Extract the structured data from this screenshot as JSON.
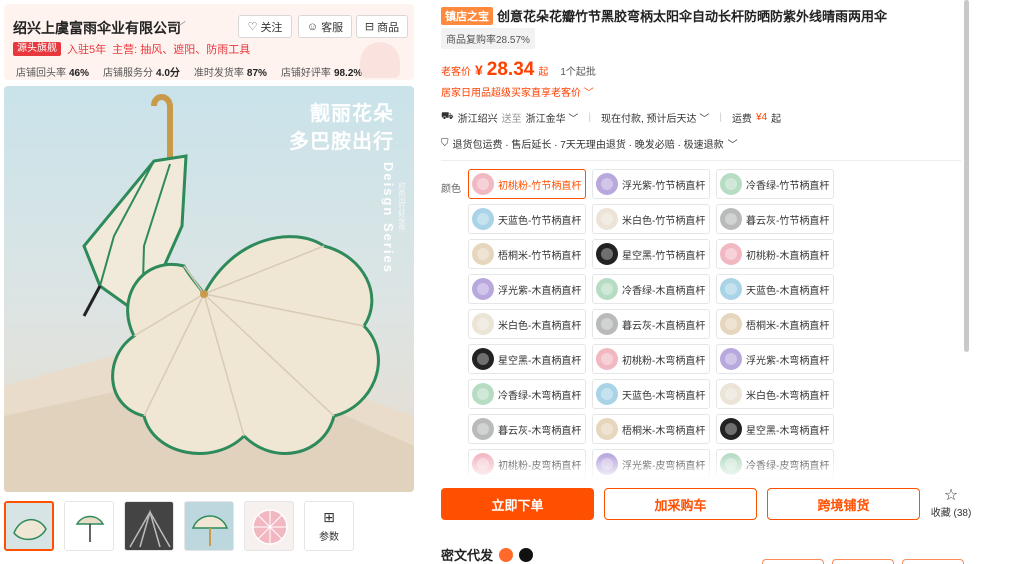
{
  "shop": {
    "name": "绍兴上虞富雨伞业有限公司",
    "follow_label": "关注",
    "service_label": "客服",
    "store_label": "商品",
    "badge": "源头旗舰",
    "years": "入驻5年",
    "main_products": "主营: 抽风、遮阳、防雨工具",
    "stats": [
      {
        "label": "店铺回头率",
        "value": "46%"
      },
      {
        "label": "店铺服务分",
        "value": "4.0分"
      },
      {
        "label": "准时发货率",
        "value": "87%"
      },
      {
        "label": "店铺好评率",
        "value": "98.2%"
      }
    ]
  },
  "main_image": {
    "headline_1": "靓丽花朵",
    "headline_2": "多巴胺出行",
    "series_text": "Deisgn Series",
    "series_sub": "时尚出行好伙伴"
  },
  "thumbnails": {
    "params_label": "参数"
  },
  "product": {
    "store_badge": "镇店之宝",
    "title": "创意花朵花瓣竹节黑胶弯柄太阳伞自动长杆防晒防紫外线晴雨两用伞",
    "repurchase": "商品复购率28.57%",
    "price_label": "老客价",
    "currency": "¥",
    "price": "28.34",
    "price_unit": "起",
    "min_order": "1个起批",
    "promo": "居家日用品超级买家直享老客价",
    "ship_from": "浙江绍兴",
    "ship_to_label": "送至",
    "ship_to": "浙江金华",
    "ship_time": "现在付款, 预计后天达",
    "freight_label": "运费",
    "freight": "¥4",
    "freight_unit": "起",
    "services": "退货包运费 · 售后延长 · 7天无理由退货 · 晚发必赔 · 极速退款",
    "color_label": "颜色"
  },
  "colors": [
    {
      "label": "初桃粉-竹节柄直杆",
      "color": "#f2b8c2",
      "selected": true
    },
    {
      "label": "浮光紫-竹节柄直杆",
      "color": "#b9a8dd"
    },
    {
      "label": "冷香绿-竹节柄直杆",
      "color": "#b7dcc4"
    },
    {
      "label": "天蓝色-竹节柄直杆",
      "color": "#a9d3e6"
    },
    {
      "label": "米白色-竹节柄直杆",
      "color": "#ece4d6"
    },
    {
      "label": "暮云灰-竹节柄直杆",
      "color": "#b9babb"
    },
    {
      "label": "梧桐米-竹节柄直杆",
      "color": "#e6d6bd"
    },
    {
      "label": "星空黑-竹节柄直杆",
      "color": "#222222"
    },
    {
      "label": "初桃粉-木直柄直杆",
      "color": "#f2b8c2"
    },
    {
      "label": "浮光紫-木直柄直杆",
      "color": "#b9a8dd"
    },
    {
      "label": "冷香绿-木直柄直杆",
      "color": "#b7dcc4"
    },
    {
      "label": "天蓝色-木直柄直杆",
      "color": "#a9d3e6"
    },
    {
      "label": "米白色-木直柄直杆",
      "color": "#ece4d6"
    },
    {
      "label": "暮云灰-木直柄直杆",
      "color": "#b9babb"
    },
    {
      "label": "梧桐米-木直柄直杆",
      "color": "#e6d6bd"
    },
    {
      "label": "星空黑-木直柄直杆",
      "color": "#222222"
    },
    {
      "label": "初桃粉-木弯柄直杆",
      "color": "#f2b8c2"
    },
    {
      "label": "浮光紫-木弯柄直杆",
      "color": "#b9a8dd"
    },
    {
      "label": "冷香绿-木弯柄直杆",
      "color": "#b7dcc4"
    },
    {
      "label": "天蓝色-木弯柄直杆",
      "color": "#a9d3e6"
    },
    {
      "label": "米白色-木弯柄直杆",
      "color": "#ece4d6"
    },
    {
      "label": "暮云灰-木弯柄直杆",
      "color": "#b9babb"
    },
    {
      "label": "梧桐米-木弯柄直杆",
      "color": "#e6d6bd"
    },
    {
      "label": "星空黑-木弯柄直杆",
      "color": "#222222"
    },
    {
      "label": "初桃粉-皮弯柄直杆",
      "color": "#f2b8c2"
    },
    {
      "label": "浮光紫-皮弯柄直杆",
      "color": "#b9a8dd"
    },
    {
      "label": "冷香绿-皮弯柄直杆",
      "color": "#b7dcc4"
    }
  ],
  "actions": {
    "buy": "立即下单",
    "cart": "加采购车",
    "cross_border": "跨境铺货",
    "favorite_label": "收藏",
    "favorite_count": "(38)"
  },
  "bottom": {
    "title": "密文代发"
  },
  "theme": {
    "accent": "#ff4f00",
    "highlight": "#ff5000"
  }
}
